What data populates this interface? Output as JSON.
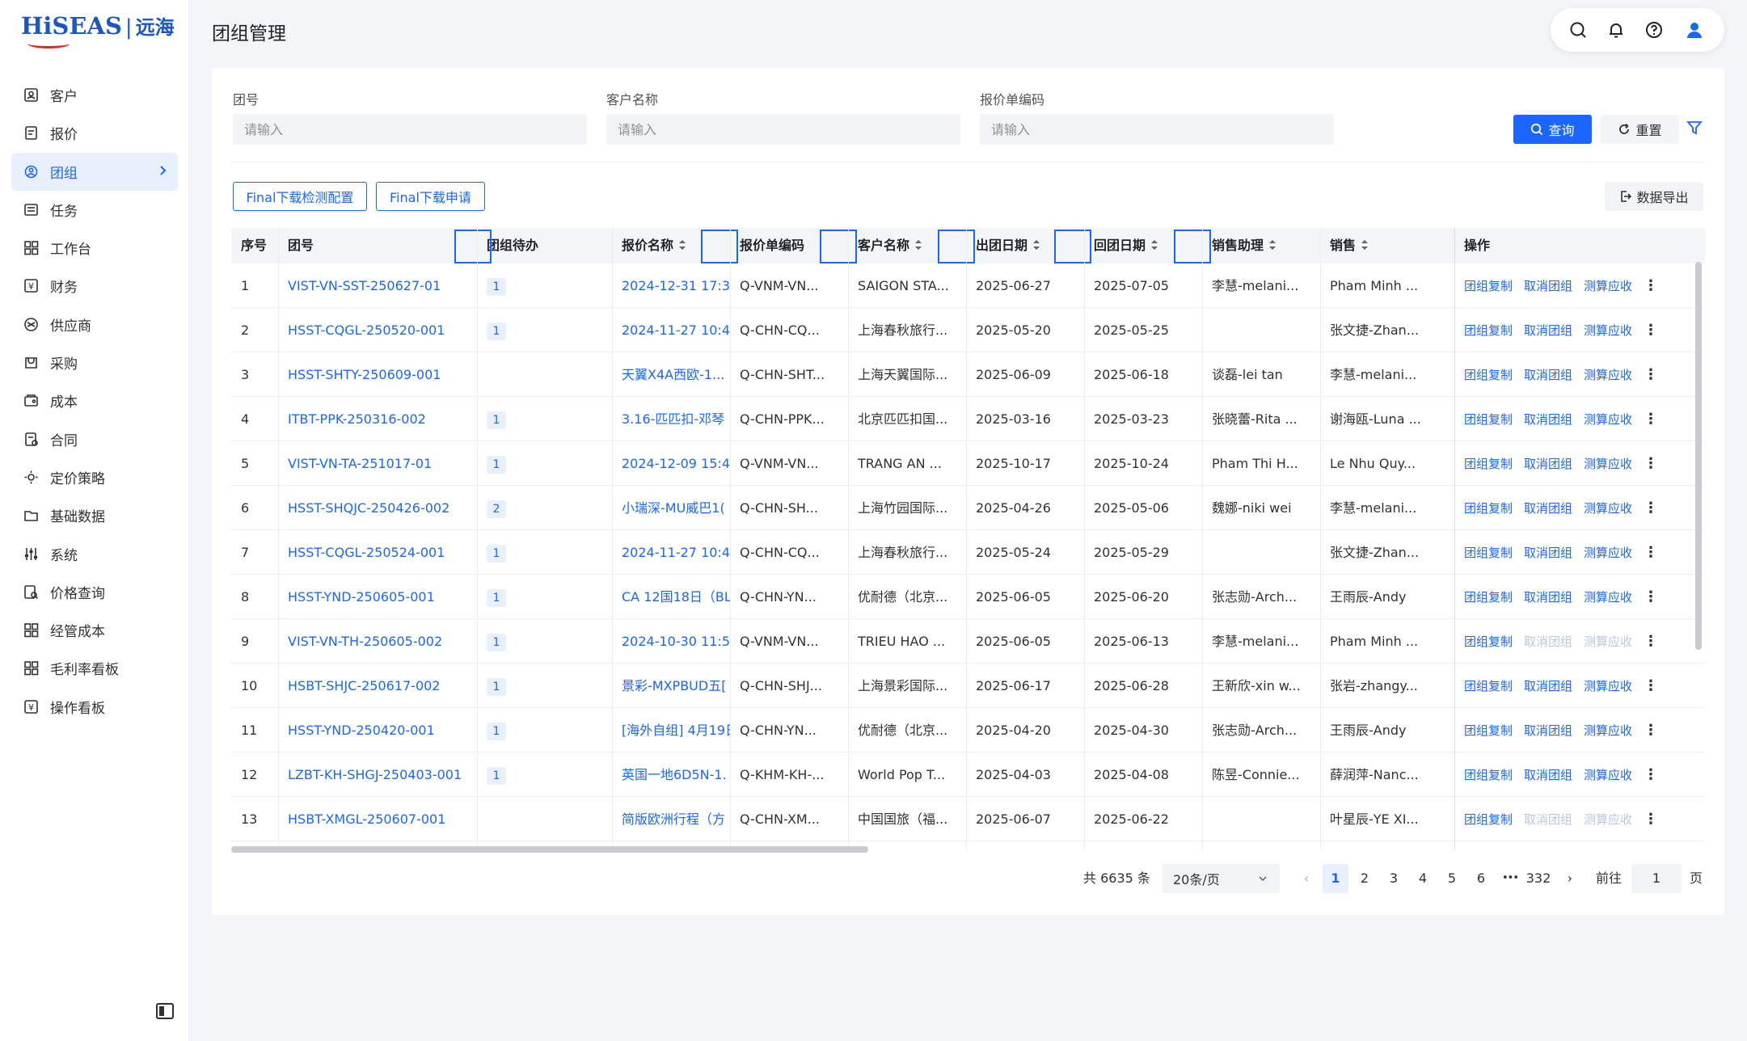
{
  "logo": {
    "main": "HiSEAS",
    "cn": "远海"
  },
  "page_title": "团组管理",
  "nav": [
    {
      "label": "客户",
      "icon": "customer-icon"
    },
    {
      "label": "报价",
      "icon": "quote-icon"
    },
    {
      "label": "团组",
      "icon": "group-icon",
      "active": true
    },
    {
      "label": "任务",
      "icon": "task-icon"
    },
    {
      "label": "工作台",
      "icon": "workbench-icon"
    },
    {
      "label": "财务",
      "icon": "finance-icon"
    },
    {
      "label": "供应商",
      "icon": "supplier-icon"
    },
    {
      "label": "采购",
      "icon": "purchase-icon"
    },
    {
      "label": "成本",
      "icon": "cost-icon"
    },
    {
      "label": "合同",
      "icon": "contract-icon"
    },
    {
      "label": "定价策略",
      "icon": "pricing-icon"
    },
    {
      "label": "基础数据",
      "icon": "folder-icon"
    },
    {
      "label": "系统",
      "icon": "settings-sliders-icon"
    },
    {
      "label": "价格查询",
      "icon": "price-search-icon"
    },
    {
      "label": "经管成本",
      "icon": "grid-icon"
    },
    {
      "label": "毛利率看板",
      "icon": "dashboard-icon"
    },
    {
      "label": "操作看板",
      "icon": "ops-board-icon"
    }
  ],
  "filters": {
    "group_no": {
      "label": "团号",
      "placeholder": "请输入"
    },
    "customer": {
      "label": "客户名称",
      "placeholder": "请输入"
    },
    "quote_code": {
      "label": "报价单编码",
      "placeholder": "请输入"
    },
    "query_btn": "查询",
    "reset_btn": "重置"
  },
  "actions": {
    "final_config": "Final下载检测配置",
    "final_apply": "Final下载申请",
    "export": "数据导出"
  },
  "table": {
    "headers": [
      "序号",
      "团号",
      "团组待办",
      "报价名称",
      "报价单编码",
      "客户名称",
      "出团日期",
      "回团日期",
      "销售助理",
      "销售",
      "操作"
    ],
    "row_actions": [
      "团组复制",
      "取消团组",
      "测算应收"
    ],
    "rows": [
      {
        "no": "1",
        "group": "VIST-VN-SST-250627-01",
        "todo": "1",
        "quote": "2024-12-31 17:3",
        "code": "Q-VNM-VN...",
        "customer": "SAIGON STA...",
        "out": "2025-06-27",
        "back": "2025-07-05",
        "assistant": "李慧-melani...",
        "sales": "Pham Minh ...",
        "disabled": false
      },
      {
        "no": "2",
        "group": "HSST-CQGL-250520-001",
        "todo": "1",
        "quote": "2024-11-27 10:4",
        "code": "Q-CHN-CQ...",
        "customer": "上海春秋旅行...",
        "out": "2025-05-20",
        "back": "2025-05-25",
        "assistant": "",
        "sales": "张文捷-Zhan...",
        "disabled": false
      },
      {
        "no": "3",
        "group": "HSST-SHTY-250609-001",
        "todo": "",
        "quote": "天翼X4A西欧-1...",
        "code": "Q-CHN-SHT...",
        "customer": "上海天翼国际...",
        "out": "2025-06-09",
        "back": "2025-06-18",
        "assistant": "谈磊-lei tan",
        "sales": "李慧-melani...",
        "disabled": false
      },
      {
        "no": "4",
        "group": "ITBT-PPK-250316-002",
        "todo": "1",
        "quote": "3.16-匹匹扣-邓琴",
        "code": "Q-CHN-PPK...",
        "customer": "北京匹匹扣国...",
        "out": "2025-03-16",
        "back": "2025-03-23",
        "assistant": "张晓蕾-Rita ...",
        "sales": "谢海瓯-Luna ...",
        "disabled": false
      },
      {
        "no": "5",
        "group": "VIST-VN-TA-251017-01",
        "todo": "1",
        "quote": "2024-12-09 15:4",
        "code": "Q-VNM-VN...",
        "customer": "TRANG AN ...",
        "out": "2025-10-17",
        "back": "2025-10-24",
        "assistant": "Pham Thi H...",
        "sales": "Le Nhu Quy...",
        "disabled": false
      },
      {
        "no": "6",
        "group": "HSST-SHQJC-250426-002",
        "todo": "2",
        "quote": "小瑞深-MU威巴1(",
        "code": "Q-CHN-SH...",
        "customer": "上海竹园国际...",
        "out": "2025-04-26",
        "back": "2025-05-06",
        "assistant": "魏娜-niki wei",
        "sales": "李慧-melani...",
        "disabled": false
      },
      {
        "no": "7",
        "group": "HSST-CQGL-250524-001",
        "todo": "1",
        "quote": "2024-11-27 10:4",
        "code": "Q-CHN-CQ...",
        "customer": "上海春秋旅行...",
        "out": "2025-05-24",
        "back": "2025-05-29",
        "assistant": "",
        "sales": "张文捷-Zhan...",
        "disabled": false
      },
      {
        "no": "8",
        "group": "HSST-YND-250605-001",
        "todo": "1",
        "quote": "CA 12国18日（BL",
        "code": "Q-CHN-YN...",
        "customer": "优耐德（北京...",
        "out": "2025-06-05",
        "back": "2025-06-20",
        "assistant": "张志勋-Arch...",
        "sales": "王雨辰-Andy",
        "disabled": false
      },
      {
        "no": "9",
        "group": "VIST-VN-TH-250605-002",
        "todo": "1",
        "quote": "2024-10-30 11:5",
        "code": "Q-VNM-VN...",
        "customer": "TRIEU HAO ...",
        "out": "2025-06-05",
        "back": "2025-06-13",
        "assistant": "李慧-melani...",
        "sales": "Pham Minh ...",
        "disabled": true
      },
      {
        "no": "10",
        "group": "HSBT-SHJC-250617-002",
        "todo": "1",
        "quote": "景彩-MXPBUD五[",
        "code": "Q-CHN-SHJ...",
        "customer": "上海景彩国际...",
        "out": "2025-06-17",
        "back": "2025-06-28",
        "assistant": "王新欣-xin w...",
        "sales": "张岩-zhangy...",
        "disabled": false
      },
      {
        "no": "11",
        "group": "HSST-YND-250420-001",
        "todo": "1",
        "quote": "[海外自组] 4月19日",
        "code": "Q-CHN-YN...",
        "customer": "优耐德（北京...",
        "out": "2025-04-20",
        "back": "2025-04-30",
        "assistant": "张志勋-Arch...",
        "sales": "王雨辰-Andy",
        "disabled": false
      },
      {
        "no": "12",
        "group": "LZBT-KH-SHGJ-250403-001",
        "todo": "1",
        "quote": "英国一地6D5N-1.",
        "code": "Q-KHM-KH-...",
        "customer": "World Pop T...",
        "out": "2025-04-03",
        "back": "2025-04-08",
        "assistant": "陈昱-Connie...",
        "sales": "薛润萍-Nanc...",
        "disabled": false
      },
      {
        "no": "13",
        "group": "HSBT-XMGL-250607-001",
        "todo": "",
        "quote": "简版欧洲行程（方",
        "code": "Q-CHN-XM...",
        "customer": "中国国旅（福...",
        "out": "2025-06-07",
        "back": "2025-06-22",
        "assistant": "",
        "sales": "叶星辰-YE XI...",
        "disabled": true
      }
    ]
  },
  "pagination": {
    "total": "共 6635 条",
    "page_size": "20条/页",
    "pages": [
      "1",
      "2",
      "3",
      "4",
      "5",
      "6"
    ],
    "ellipsis": "•••",
    "last": "332",
    "goto_label": "前往",
    "goto_value": "1",
    "page_suffix": "页"
  }
}
